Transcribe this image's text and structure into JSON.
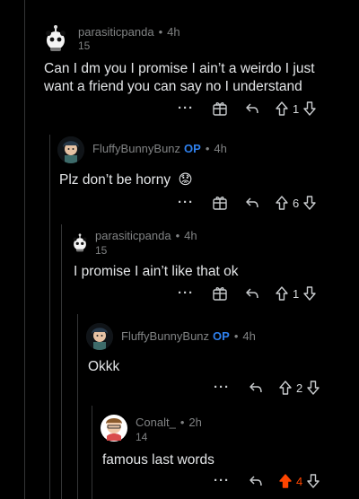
{
  "comments": [
    {
      "username": "parasiticpanda",
      "op": "",
      "age": "4h",
      "score": "15",
      "text": "Can I dm you I promise I ain’t a weirdo I just",
      "text2": "want a friend you can say no I understand",
      "votes": "1"
    },
    {
      "username": "FluffyBunnyBunz",
      "op": "OP",
      "age": "4h",
      "text": "Plz don’t be horny",
      "emoji": "😟",
      "votes": "6"
    },
    {
      "username": "parasiticpanda",
      "op": "",
      "age": "4h",
      "score": "15",
      "text": "I promise I ain’t like that ok",
      "votes": "1"
    },
    {
      "username": "FluffyBunnyBunz",
      "op": "OP",
      "age": "4h",
      "text": "Okkk",
      "votes": "2"
    },
    {
      "username": "Conalt_",
      "op": "",
      "age": "2h",
      "score": "14",
      "text": "famous last words",
      "votes": "4"
    }
  ],
  "ui": {
    "separator": "•",
    "more_label": "···"
  },
  "colors": {
    "background": "#000000",
    "op_blue": "#2f80ed",
    "upvoted": "#ff4500",
    "muted": "#818384"
  }
}
